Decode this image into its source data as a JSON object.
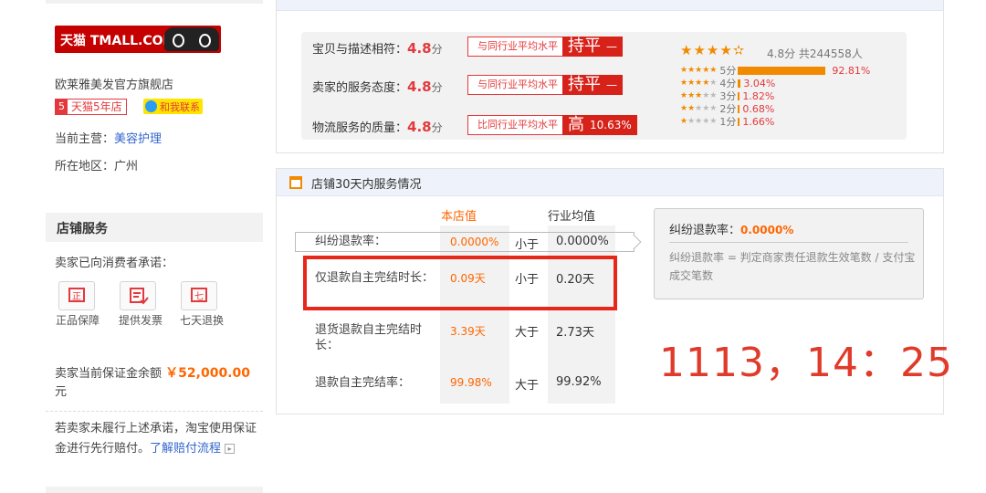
{
  "left": {
    "logo_text": "天猫 TMALL.COM",
    "shop_name": "欧莱雅美发官方旗舰店",
    "badge_years_num": "5",
    "badge_years_text": "天猫5年店",
    "contact_label": "和我联系",
    "category_label": "当前主营：",
    "category_value": "美容护理",
    "location": "所在地区：广州",
    "service_title": "店铺服务",
    "promise_intro": "卖家已向消费者承诺：",
    "promises": [
      "正品保障",
      "提供发票",
      "七天退换"
    ],
    "deposit_label": "卖家当前保证金余额",
    "deposit_amount": "￥52,000.00",
    "deposit_unit": "元",
    "claim_text": "若卖家未履行上述承诺，淘宝使用保证金进行先行赔付。",
    "claim_link": "了解赔付流程"
  },
  "ratings": {
    "rows": [
      {
        "label": "宝贝与描述相符：",
        "score": "4.8",
        "unit": "分",
        "compare": "与同行业平均水平",
        "result": "持平",
        "suffix": "—",
        "pct": ""
      },
      {
        "label": "卖家的服务态度：",
        "score": "4.8",
        "unit": "分",
        "compare": "与同行业平均水平",
        "result": "持平",
        "suffix": "—",
        "pct": ""
      },
      {
        "label": "物流服务的质量：",
        "score": "4.8",
        "unit": "分",
        "compare": "比同行业平均水平",
        "result": "高",
        "suffix": "",
        "pct": "10.63%"
      }
    ],
    "overall_score": "4.8分",
    "total_count": "共244558人",
    "distribution": [
      {
        "stars": 5,
        "label": "5分",
        "pct": "92.81%",
        "fraction": 0.9281
      },
      {
        "stars": 4,
        "label": "4分",
        "pct": "3.04%",
        "fraction": 0.0304
      },
      {
        "stars": 3,
        "label": "3分",
        "pct": "1.82%",
        "fraction": 0.0182
      },
      {
        "stars": 2,
        "label": "2分",
        "pct": "0.68%",
        "fraction": 0.0068
      },
      {
        "stars": 1,
        "label": "1分",
        "pct": "1.66%",
        "fraction": 0.0166
      }
    ],
    "star_color": "#f28a00",
    "accent_red": "#d7221a"
  },
  "service30": {
    "title": "店铺30天内服务情况",
    "col_shop": "本店值",
    "col_industry": "行业均值",
    "rows": [
      {
        "label": "纠纷退款率：",
        "shop": "0.0000%",
        "cmp": "小于",
        "industry": "0.0000%"
      },
      {
        "label": "仅退款自主完结时长：",
        "shop": "0.09天",
        "cmp": "小于",
        "industry": "0.20天"
      },
      {
        "label": "退货退款自主完结时长：",
        "shop": "3.39天",
        "cmp": "大于",
        "industry": "2.73天"
      },
      {
        "label": "退款自主完结率：",
        "shop": "99.98%",
        "cmp": "大于",
        "industry": "99.92%"
      }
    ],
    "info_title": "纠纷退款率：",
    "info_value": "0.0000%",
    "info_desc": "纠纷退款率 = 判定商家责任退款生效笔数 / 支付宝成交笔数"
  },
  "overlay_timestamp": "1113，14：25"
}
